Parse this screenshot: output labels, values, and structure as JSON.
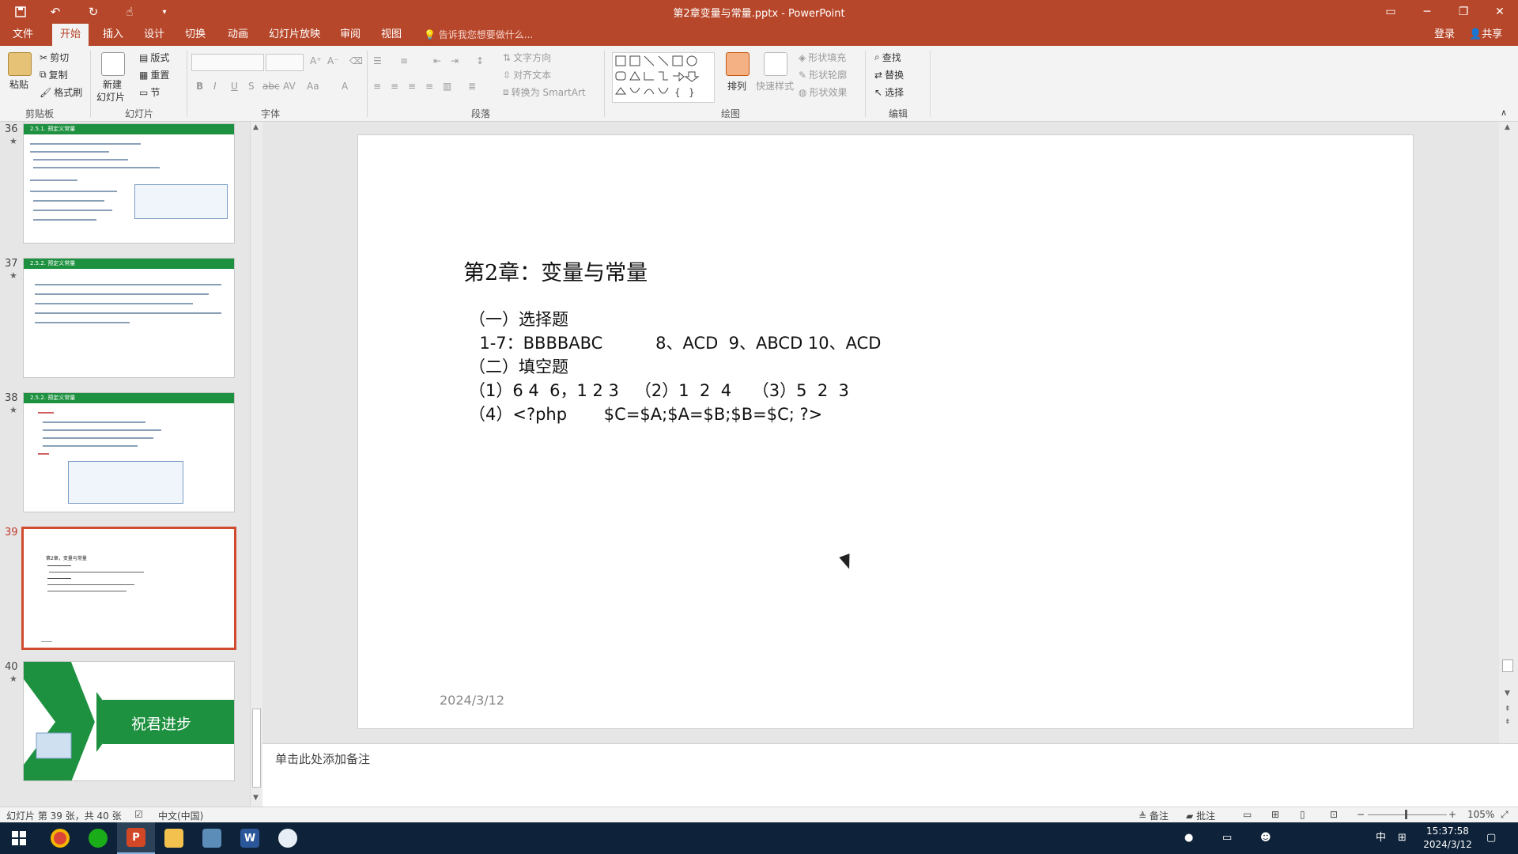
{
  "window": {
    "title": "第2章变量与常量.pptx - PowerPoint",
    "controls": {
      "ribbon_display": "ribbon-display-icon",
      "minimize": "minimize-icon",
      "restore": "restore-icon",
      "close": "close-icon"
    }
  },
  "quick_access": [
    "save-icon",
    "undo-icon",
    "redo-icon",
    "touch-mode-icon",
    "customize-icon"
  ],
  "tabs": [
    {
      "label": "文件",
      "active": false
    },
    {
      "label": "开始",
      "active": true
    },
    {
      "label": "插入",
      "active": false
    },
    {
      "label": "设计",
      "active": false
    },
    {
      "label": "切换",
      "active": false
    },
    {
      "label": "动画",
      "active": false
    },
    {
      "label": "幻灯片放映",
      "active": false
    },
    {
      "label": "审阅",
      "active": false
    },
    {
      "label": "视图",
      "active": false
    }
  ],
  "tell_me": "告诉我您想要做什么...",
  "account": {
    "login": "登录",
    "share": "共享"
  },
  "ribbon": {
    "clipboard": {
      "paste": "粘贴",
      "cut": "剪切",
      "copy": "复制",
      "format_painter": "格式刷",
      "group": "剪贴板"
    },
    "slides": {
      "new_slide": "新建",
      "new_slide2": "幻灯片",
      "layout": "版式",
      "reset": "重置",
      "section": "节",
      "group": "幻灯片"
    },
    "font": {
      "group": "字体",
      "bold": "B",
      "italic": "I",
      "underline": "U",
      "shadow": "S",
      "strike": "abc",
      "spacing": "AV",
      "case": "Aa",
      "color": "A"
    },
    "paragraph": {
      "text_direction": "文字方向",
      "align_text": "对齐文本",
      "smartart": "转换为 SmartArt",
      "group": "段落"
    },
    "drawing": {
      "arrange": "排列",
      "quick_styles": "快速样式",
      "shape_fill": "形状填充",
      "shape_outline": "形状轮廓",
      "shape_effects": "形状效果",
      "group": "绘图"
    },
    "editing": {
      "find": "查找",
      "replace": "替换",
      "select": "选择",
      "group": "编辑"
    }
  },
  "thumbnails": [
    {
      "number": "36",
      "star": "★",
      "header": "2.5.1. 预定义常量"
    },
    {
      "number": "37",
      "star": "★",
      "header": "2.5.2. 预定义常量"
    },
    {
      "number": "38",
      "star": "★",
      "header": "2.5.2. 预定义常量"
    },
    {
      "number": "39",
      "star": "",
      "header": "第2章，变量与常量"
    },
    {
      "number": "40",
      "star": "★",
      "header": "祝君进步"
    }
  ],
  "slide": {
    "title": "第2章：变量与常量",
    "lines": [
      "（一）选择题",
      "  1-7：BBBBABC          8、ACD  9、ABCD 10、ACD",
      "（二）填空题",
      "（1）6 4  6，1 2 3   （2）1  2  4    （3）5  2  3",
      "（4）<?php       $C=$A;$A=$B;$B=$C; ?>"
    ],
    "date": "2024/3/12"
  },
  "notes_placeholder": "单击此处添加备注",
  "status": {
    "slide_info": "幻灯片 第 39 张，共 40 张",
    "language": "中文(中国)",
    "notes": "备注",
    "comments": "批注",
    "zoom": "105%"
  },
  "taskbar": {
    "apps": [
      "start-icon",
      "chrome-icon",
      "wechat-icon",
      "powerpoint-icon",
      "file-explorer-icon",
      "app-icon",
      "word-icon",
      "feishu-icon"
    ],
    "ime": "中",
    "time": "15:37:58",
    "date": "2024/3/12"
  },
  "colors": {
    "accent": "#b7472a",
    "selection": "#d04a2f",
    "thumb_header": "#1e9140",
    "taskbar": "#0e2339"
  }
}
